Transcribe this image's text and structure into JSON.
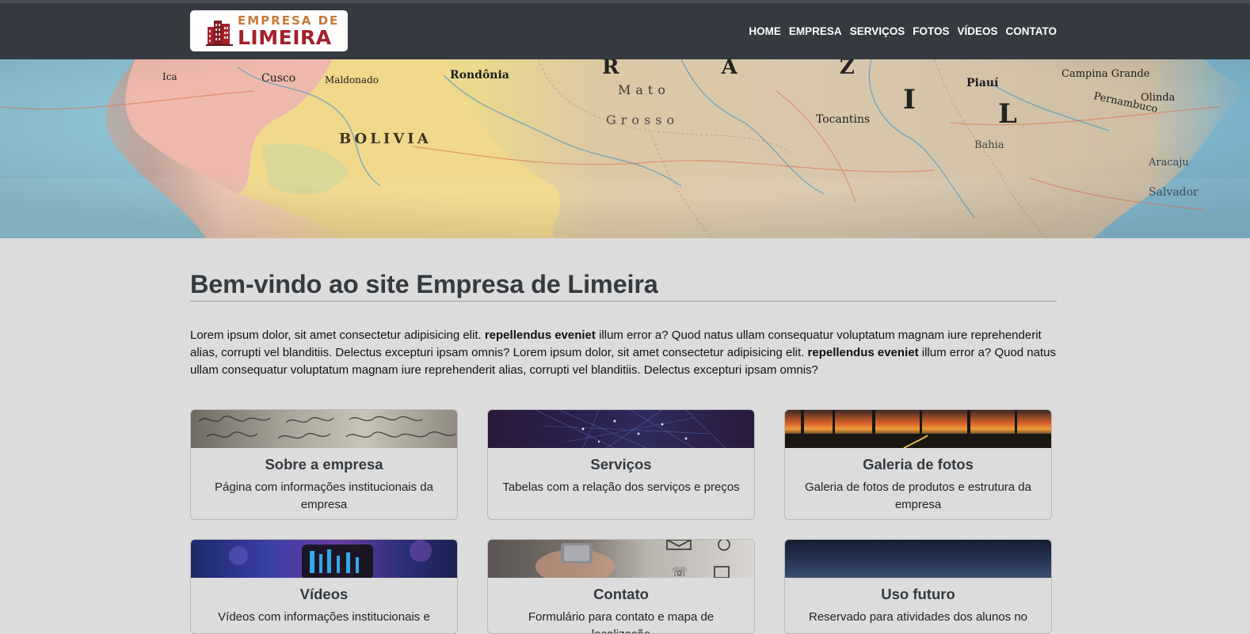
{
  "logo": {
    "line1": "EMPRESA DE",
    "line2": "LIMEIRA",
    "icon": "building-icon"
  },
  "nav": [
    "HOME",
    "EMPRESA",
    "SERVIÇOS",
    "FOTOS",
    "VÍDEOS",
    "CONTATO"
  ],
  "hero": {
    "map_labels": [
      "Rondônia",
      "BOLIVIA",
      "Maldonado",
      "Cusco",
      "Ica",
      "Mato",
      "Grosso",
      "Tocantins",
      "Piauí",
      "Pernambuco",
      "Olinda",
      "Campina Grande",
      "Aracaju",
      "Salvador",
      "Bahia",
      "R  A  Z  I  L"
    ]
  },
  "main": {
    "title": "Bem-vindo ao site Empresa de Limeira",
    "intro": {
      "p1": "Lorem ipsum dolor, sit amet consectetur adipisicing elit.",
      "b1": "repellendus eveniet",
      "p2": "illum error a? Quod natus ullam consequatur voluptatum magnam iure reprehenderit alias, corrupti vel blanditiis. Delectus excepturi ipsam omnis? Lorem ipsum dolor, sit amet consectetur adipisicing elit.",
      "b2": "repellendus eveniet",
      "p3": "illum error a? Quod natus ullam consequatur voluptatum magnam iure reprehenderit alias, corrupti vel blanditiis. Delectus excepturi ipsam omnis?"
    }
  },
  "cards": [
    {
      "title": "Sobre a empresa",
      "text": "Página com informações institucionais da empresa"
    },
    {
      "title": "Serviços",
      "text": "Tabelas com a relação dos serviços e preços"
    },
    {
      "title": "Galeria de fotos",
      "text": "Galeria de fotos de produtos e estrutura da empresa"
    },
    {
      "title": "Vídeos",
      "text": "Vídeos com informações institucionais e"
    },
    {
      "title": "Contato",
      "text": "Formulário para contato e mapa de localização"
    },
    {
      "title": "Uso futuro",
      "text": "Reservado para atividades dos alunos no"
    }
  ]
}
